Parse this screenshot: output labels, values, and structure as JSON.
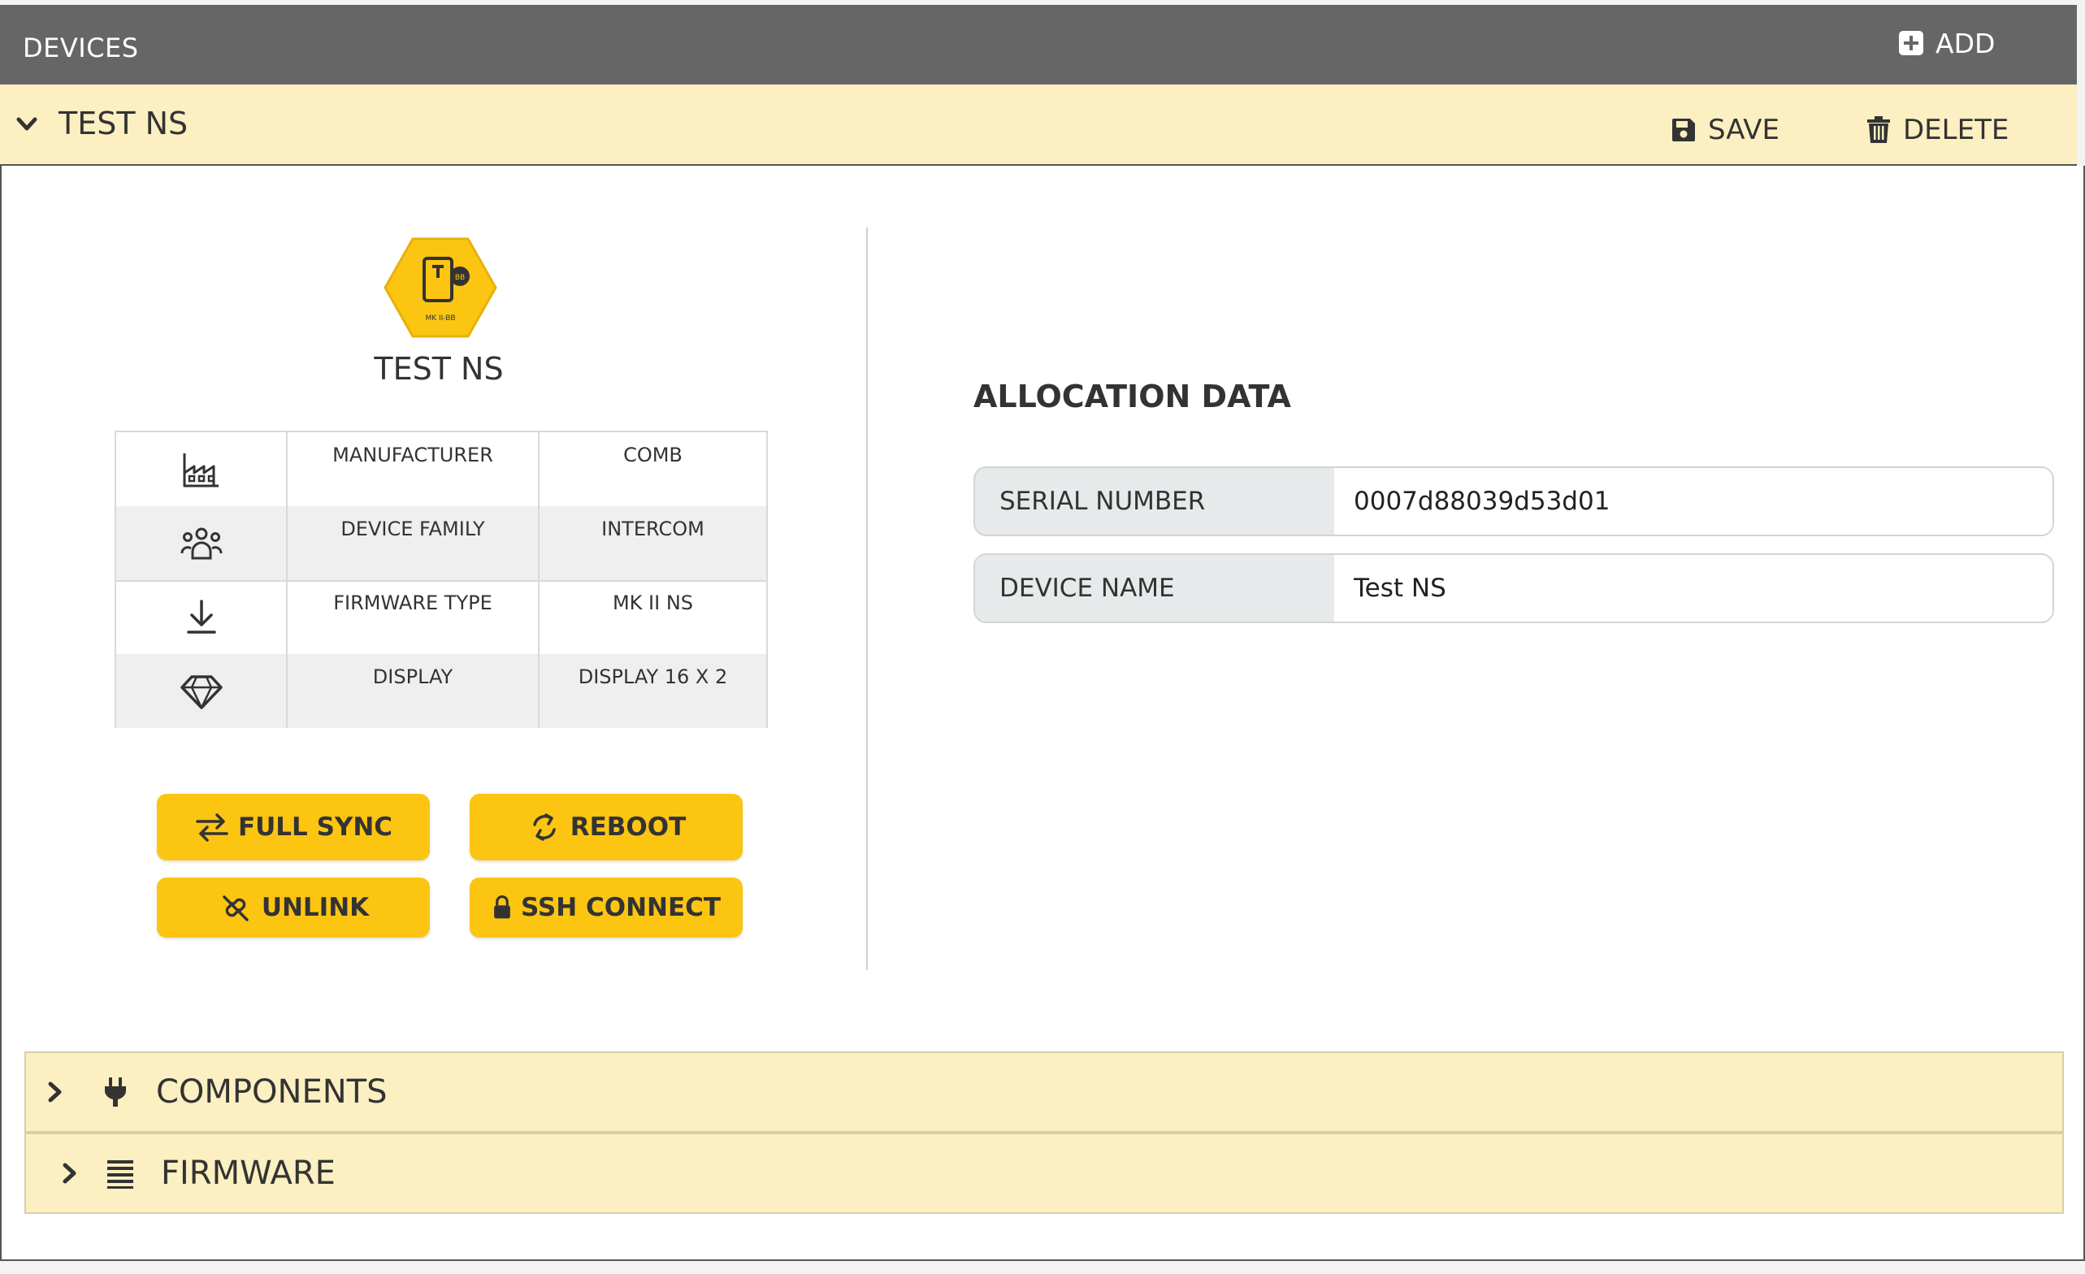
{
  "header": {
    "title": "DEVICES",
    "add_label": "ADD"
  },
  "device_bar": {
    "title": "TEST NS",
    "save_label": "SAVE",
    "delete_label": "DELETE"
  },
  "device": {
    "name": "TEST NS",
    "badge_text": "MK II-BB",
    "specs": [
      {
        "icon": "factory-icon",
        "key": "MANUFACTURER",
        "value": "COMB"
      },
      {
        "icon": "users-icon",
        "key": "DEVICE FAMILY",
        "value": "INTERCOM"
      },
      {
        "icon": "download-icon",
        "key": "FIRMWARE TYPE",
        "value": "MK II NS"
      },
      {
        "icon": "diamond-icon",
        "key": "DISPLAY",
        "value": "DISPLAY 16 X 2"
      }
    ]
  },
  "actions": {
    "full_sync": "FULL SYNC",
    "reboot": "REBOOT",
    "unlink": "UNLINK",
    "ssh_connect": "SSH CONNECT"
  },
  "allocation": {
    "title": "ALLOCATION DATA",
    "serial_label": "SERIAL NUMBER",
    "serial_value": "0007d88039d53d01",
    "name_label": "DEVICE NAME",
    "name_value": "Test NS"
  },
  "sections": [
    {
      "icon": "plug-icon",
      "label": "COMPONENTS"
    },
    {
      "icon": "list-icon",
      "label": "FIRMWARE"
    }
  ],
  "colors": {
    "header_bg": "#666666",
    "bar_bg": "#fcefc1",
    "accent_yellow": "#fcc512",
    "field_label_bg": "#e6eaeb"
  }
}
